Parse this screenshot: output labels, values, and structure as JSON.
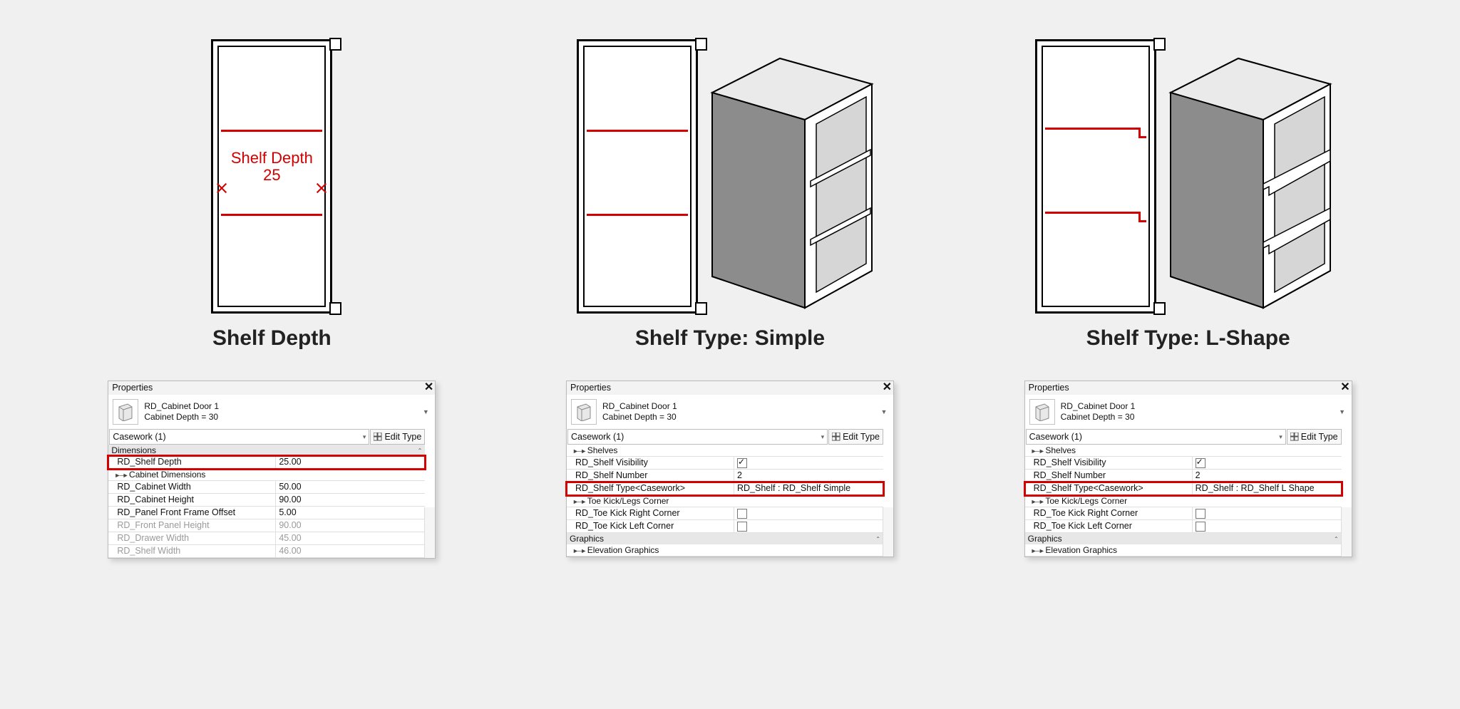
{
  "captions": {
    "depth": "Shelf Depth",
    "simple": "Shelf Type: Simple",
    "lshape": "Shelf Type: L-Shape"
  },
  "dimension_label_line1": "Shelf Depth",
  "dimension_label_line2": "25",
  "palette_common": {
    "title": "Properties",
    "family_name": "RD_Cabinet Door 1",
    "family_type": "Cabinet Depth = 30",
    "category_selector": "Casework (1)",
    "edit_type": "Edit Type"
  },
  "panels": {
    "depth": {
      "group_dimensions": "Dimensions",
      "highlighted": {
        "name": "RD_Shelf Depth",
        "value": "25.00"
      },
      "sub_cabinet_dimensions": "Cabinet Dimensions",
      "rows": [
        {
          "name": "RD_Cabinet Width",
          "value": "50.00"
        },
        {
          "name": "RD_Cabinet Height",
          "value": "90.00"
        },
        {
          "name": "RD_Panel Front Frame Offset",
          "value": "5.00"
        },
        {
          "name": "RD_Front Panel Height",
          "value": "90.00",
          "disabled": true
        },
        {
          "name": "RD_Drawer Width",
          "value": "45.00",
          "disabled": true
        },
        {
          "name": "RD_Shelf Width",
          "value": "46.00",
          "disabled": true
        }
      ]
    },
    "simple": {
      "sub_shelves": "Shelves",
      "rows_top": [
        {
          "name": "RD_Shelf Visibility",
          "checkbox": true,
          "checked": true
        },
        {
          "name": "RD_Shelf Number",
          "value": "2"
        }
      ],
      "highlighted": {
        "name": "RD_Shelf Type<Casework>",
        "value": "RD_Shelf : RD_Shelf Simple"
      },
      "sub_toe": "Toe Kick/Legs Corner",
      "rows_toe": [
        {
          "name": "RD_Toe Kick Right Corner",
          "checkbox": true,
          "checked": false
        },
        {
          "name": "RD_Toe Kick Left Corner",
          "checkbox": true,
          "checked": false
        }
      ],
      "group_graphics": "Graphics",
      "sub_elevation": "Elevation Graphics"
    },
    "lshape": {
      "sub_shelves": "Shelves",
      "rows_top": [
        {
          "name": "RD_Shelf Visibility",
          "checkbox": true,
          "checked": true
        },
        {
          "name": "RD_Shelf Number",
          "value": "2"
        }
      ],
      "highlighted": {
        "name": "RD_Shelf Type<Casework>",
        "value": "RD_Shelf : RD_Shelf L Shape"
      },
      "sub_toe": "Toe Kick/Legs Corner",
      "rows_toe": [
        {
          "name": "RD_Toe Kick Right Corner",
          "checkbox": true,
          "checked": false
        },
        {
          "name": "RD_Toe Kick Left Corner",
          "checkbox": true,
          "checked": false
        }
      ],
      "group_graphics": "Graphics",
      "sub_elevation": "Elevation Graphics"
    }
  }
}
